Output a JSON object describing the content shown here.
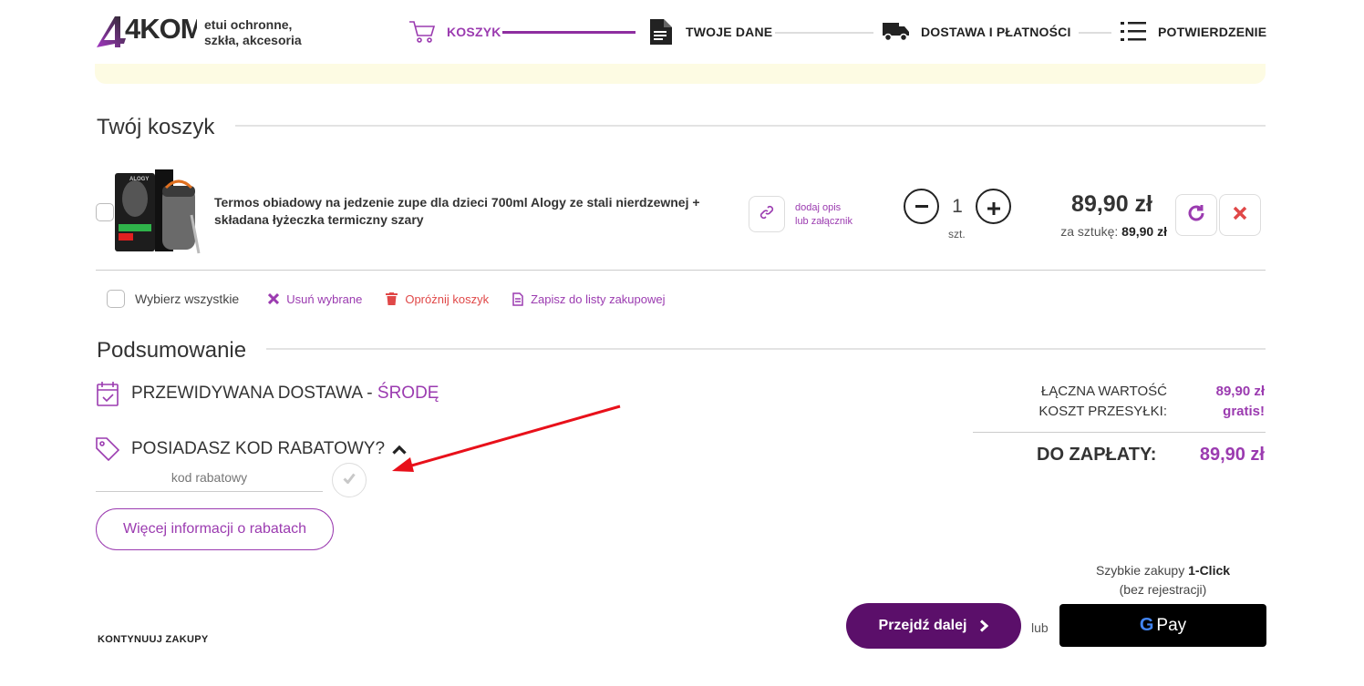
{
  "header": {
    "logo_text": "4KOM",
    "tagline_line1": "etui ochronne,",
    "tagline_line2": "szkła, akcesoria",
    "steps": [
      {
        "label": "KOSZYK",
        "active": true,
        "icon": "cart-icon"
      },
      {
        "label": "TWOJE DANE",
        "active": false,
        "icon": "document-icon"
      },
      {
        "label": "DOSTAWA I PŁATNOŚCI",
        "active": false,
        "icon": "truck-icon"
      },
      {
        "label": "POTWIERDZENIE",
        "active": false,
        "icon": "list-icon"
      }
    ]
  },
  "cart": {
    "title": "Twój koszyk",
    "item": {
      "name": "Termos obiadowy na jedzenie zupe dla dzieci 700ml Alogy ze stali nierdzewnej + składana łyżeczka termiczny szary",
      "attach_line1": "dodaj opis",
      "attach_line2": "lub załącznik",
      "quantity": "1",
      "unit": "szt.",
      "price": "89,90 zł",
      "unit_price_label": "za sztukę:",
      "unit_price": "89,90 zł",
      "image_brand": "ALOGY"
    },
    "actions": {
      "select_all": "Wybierz wszystkie",
      "remove_selected": "Usuń wybrane",
      "empty_cart": "Opróżnij koszyk",
      "save_list": "Zapisz do listy zakupowej"
    }
  },
  "summary": {
    "title": "Podsumowanie",
    "delivery_label": "PRZEWIDYWANA DOSTAWA - ",
    "delivery_day": "ŚRODĘ",
    "coupon_question": "POSIADASZ KOD RABATOWY?",
    "coupon_placeholder": "kod rabatowy",
    "more_info": "Więcej informacji o rabatach",
    "total_value_label": "ŁĄCZNA WARTOŚĆ",
    "total_value": "89,90 zł",
    "shipping_label": "KOSZT PRZESYŁKI:",
    "shipping_value": "gratis!",
    "to_pay_label": "DO ZAPŁATY:",
    "to_pay_value": "89,90 zł"
  },
  "footer": {
    "continue": "KONTYNUUJ ZAKUPY",
    "proceed": "Przejdź dalej",
    "or": "lub",
    "oneclick_prefix": "Szybkie zakupy ",
    "oneclick_bold": "1-Click",
    "oneclick_sub": "(bez rejestracji)",
    "gpay_label": "Pay"
  },
  "colors": {
    "accent": "#9b3bb0",
    "button_dark": "#5b0f6a",
    "annotation_arrow": "#e8101a"
  }
}
